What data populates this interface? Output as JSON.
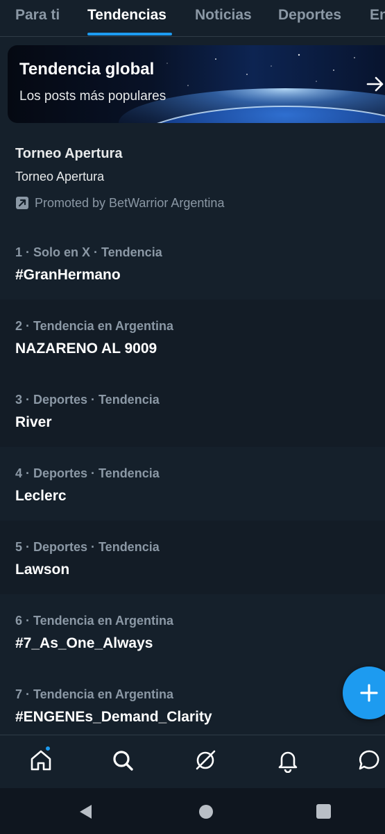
{
  "tabs": [
    {
      "label": "Para ti"
    },
    {
      "label": "Tendencias",
      "active": true
    },
    {
      "label": "Noticias"
    },
    {
      "label": "Deportes"
    },
    {
      "label": "Entretenimiento"
    }
  ],
  "banner": {
    "title": "Tendencia global",
    "subtitle": "Los posts más populares",
    "icon": "arrow-right-icon"
  },
  "promoted": {
    "title": "Torneo Apertura",
    "subtitle": "Torneo Apertura",
    "promoted_by": "Promoted by BetWarrior Argentina",
    "icon": "promoted-icon"
  },
  "trends": [
    {
      "meta": "1 · Solo en X · Tendencia",
      "name": "#GranHermano"
    },
    {
      "meta": "2 · Tendencia en Argentina",
      "name": "NAZARENO AL 9009"
    },
    {
      "meta": "3 · Deportes · Tendencia",
      "name": "River"
    },
    {
      "meta": "4 · Deportes · Tendencia",
      "name": "Leclerc"
    },
    {
      "meta": "5 · Deportes · Tendencia",
      "name": "Lawson"
    },
    {
      "meta": "6 · Tendencia en Argentina",
      "name": "#7_As_One_Always"
    },
    {
      "meta": "7 · Tendencia en Argentina",
      "name": "#ENGENEs_Demand_Clarity"
    }
  ],
  "fab": {
    "icon": "plus-icon"
  },
  "bottom_nav": {
    "items": [
      {
        "icon": "home-icon",
        "has_notification_dot": true
      },
      {
        "icon": "search-icon"
      },
      {
        "icon": "grok-icon"
      },
      {
        "icon": "bell-icon"
      },
      {
        "icon": "messages-icon"
      }
    ]
  },
  "system_nav": {
    "items": [
      {
        "icon": "back-triangle-icon"
      },
      {
        "icon": "home-circle-icon"
      },
      {
        "icon": "recents-square-icon"
      }
    ]
  },
  "colors": {
    "background": "#15202b",
    "background_alt": "#131c26",
    "accent": "#1d9bf0",
    "secondary_text": "#8b98a5",
    "primary_text": "#ffffff"
  }
}
